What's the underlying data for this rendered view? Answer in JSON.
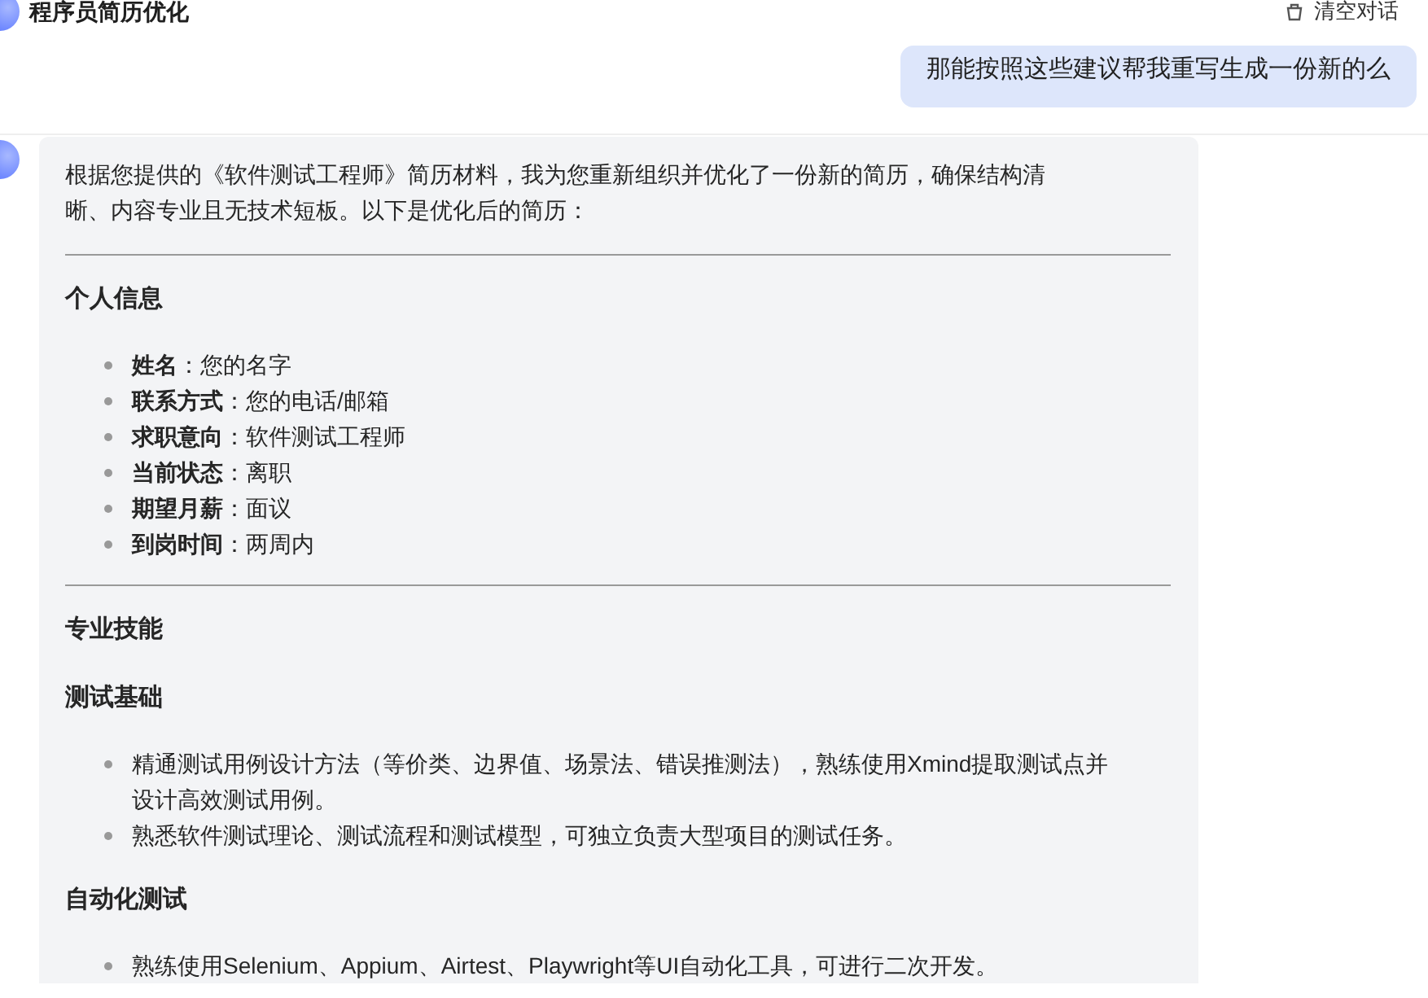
{
  "header": {
    "title": "程序员简历优化",
    "clear_button": "清空对话"
  },
  "messages": [
    {
      "kind": "user",
      "text": "那能按照这些建议帮我重写生成一份新的么"
    },
    {
      "kind": "assistant",
      "blocks": [
        {
          "kind": "paragraph",
          "text": "根据您提供的《软件测试工程师》简历材料，我为您重新组织并优化了一份新的简历，确保结构清晰、内容专业且无技术短板。以下是优化后的简历："
        },
        {
          "kind": "rule"
        },
        {
          "kind": "heading",
          "text": "个人信息"
        },
        {
          "kind": "list",
          "items": [
            {
              "label": "姓名",
              "value": "：您的名字"
            },
            {
              "label": "联系方式",
              "value": "：您的电话/邮箱"
            },
            {
              "label": "求职意向",
              "value": "：软件测试工程师"
            },
            {
              "label": "当前状态",
              "value": "：离职"
            },
            {
              "label": "期望月薪",
              "value": "：面议"
            },
            {
              "label": "到岗时间",
              "value": "：两周内"
            }
          ]
        },
        {
          "kind": "rule"
        },
        {
          "kind": "heading",
          "text": "专业技能"
        },
        {
          "kind": "heading",
          "text": "测试基础"
        },
        {
          "kind": "list",
          "items": [
            {
              "value": "精通测试用例设计方法（等价类、边界值、场景法、错误推测法），熟练使用Xmind提取测试点并设计高效测试用例。"
            },
            {
              "value": "熟悉软件测试理论、测试流程和测试模型，可独立负责大型项目的测试任务。"
            }
          ]
        },
        {
          "kind": "heading",
          "text": "自动化测试"
        },
        {
          "kind": "list",
          "items": [
            {
              "value": "熟练使用Selenium、Appium、Airtest、Playwright等UI自动化工具，可进行二次开发。"
            }
          ]
        }
      ]
    }
  ]
}
